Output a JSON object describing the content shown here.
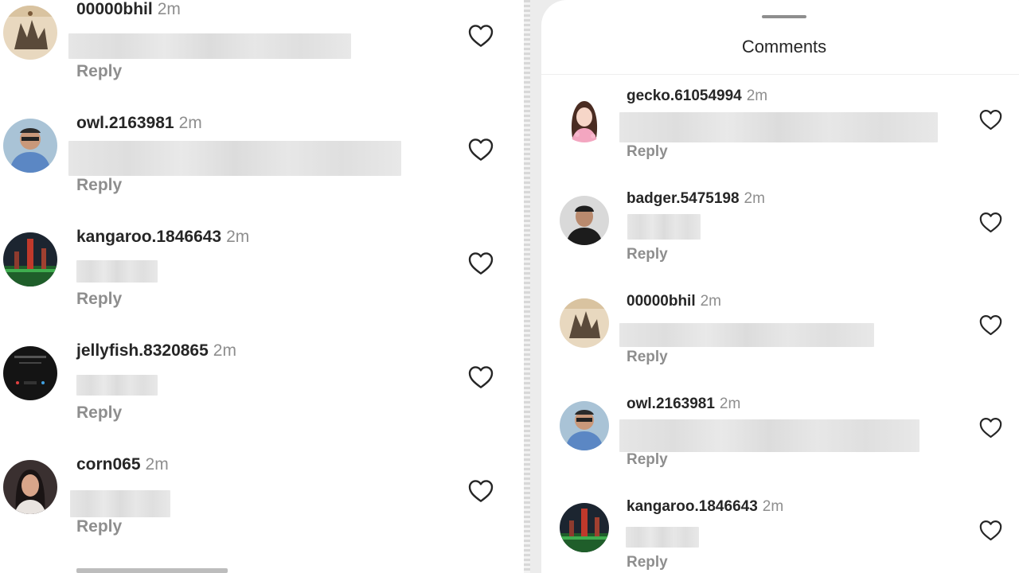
{
  "sheet": {
    "title": "Comments"
  },
  "reply_label": "Reply",
  "left_comments": [
    {
      "username": "00000bhil",
      "time": "2m",
      "avatar": "artwork-avatar",
      "liked": false
    },
    {
      "username": "owl.2163981",
      "time": "2m",
      "avatar": "man-sunglasses-avatar",
      "liked": false
    },
    {
      "username": "kangaroo.1846643",
      "time": "2m",
      "avatar": "city-night-avatar",
      "liked": false
    },
    {
      "username": "jellyfish.8320865",
      "time": "2m",
      "avatar": "dark-screen-avatar",
      "liked": false
    },
    {
      "username": "corn065",
      "time": "2m",
      "avatar": "woman-portrait-avatar",
      "liked": false
    }
  ],
  "right_comments": [
    {
      "username": "gecko.61054994",
      "time": "2m",
      "avatar": "anime-girl-avatar",
      "liked": false
    },
    {
      "username": "badger.5475198",
      "time": "2m",
      "avatar": "man-portrait-avatar",
      "liked": false
    },
    {
      "username": "00000bhil",
      "time": "2m",
      "avatar": "artwork-avatar",
      "liked": false
    },
    {
      "username": "owl.2163981",
      "time": "2m",
      "avatar": "man-sunglasses-avatar",
      "liked": false
    },
    {
      "username": "kangaroo.1846643",
      "time": "2m",
      "avatar": "city-night-avatar",
      "liked": false
    }
  ],
  "colors": {
    "text": "#262626",
    "secondary": "#8e8e8e",
    "redacted": "#e2e2e2",
    "background": "#ffffff"
  },
  "icons": {
    "like": "heart-outline-icon"
  }
}
